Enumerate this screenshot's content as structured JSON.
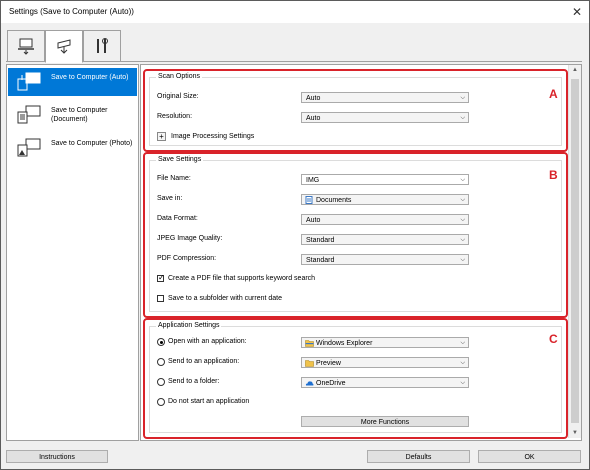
{
  "window": {
    "title": "Settings (Save to Computer (Auto))",
    "close_glyph": "✕"
  },
  "tabs": [
    {
      "name": "scan-from-computer",
      "icon": "computer-scan-icon",
      "active": false
    },
    {
      "name": "scan-from-operation-panel",
      "icon": "scanner-save-icon",
      "active": true
    },
    {
      "name": "general-settings",
      "icon": "tools-icon",
      "active": false
    }
  ],
  "sidebar": {
    "items": [
      {
        "label": "Save to Computer (Auto)",
        "icon": "save-to-computer-auto-icon",
        "selected": true
      },
      {
        "label": "Save to Computer (Document)",
        "icon": "save-to-computer-document-icon",
        "selected": false
      },
      {
        "label": "Save to Computer (Photo)",
        "icon": "save-to-computer-photo-icon",
        "selected": false
      }
    ]
  },
  "scan_options": {
    "title": "Scan Options",
    "letter": "A",
    "original_size": {
      "label": "Original Size:",
      "value": "Auto"
    },
    "resolution": {
      "label": "Resolution:",
      "value": "Auto"
    },
    "image_processing": {
      "label": "Image Processing Settings",
      "button": "+"
    }
  },
  "save_settings": {
    "title": "Save Settings",
    "letter": "B",
    "file_name": {
      "label": "File Name:",
      "value": "IMG"
    },
    "save_in": {
      "label": "Save in:",
      "value": "Documents"
    },
    "data_format": {
      "label": "Data Format:",
      "value": "Auto"
    },
    "jpeg_quality": {
      "label": "JPEG Image Quality:",
      "value": "Standard"
    },
    "pdf_compression": {
      "label": "PDF Compression:",
      "value": "Standard"
    },
    "keyword_pdf": {
      "label": "Create a PDF file that supports keyword search",
      "checked": true
    },
    "subfolder": {
      "label": "Save to a subfolder with current date",
      "checked": false
    }
  },
  "application_settings": {
    "title": "Application Settings",
    "letter": "C",
    "open_with": {
      "label": "Open with an application:",
      "value": "Windows Explorer",
      "selected": true
    },
    "send_to_app": {
      "label": "Send to an application:",
      "value": "Preview",
      "selected": false
    },
    "send_to_folder": {
      "label": "Send to a folder:",
      "value": "OneDrive",
      "selected": false
    },
    "do_not_start": {
      "label": "Do not start an application",
      "selected": false
    },
    "more_functions": "More Functions"
  },
  "footer": {
    "instructions": "Instructions",
    "defaults": "Defaults",
    "ok": "OK"
  },
  "colors": {
    "highlight": "#0078d7",
    "annotation_red": "#d9232a"
  }
}
